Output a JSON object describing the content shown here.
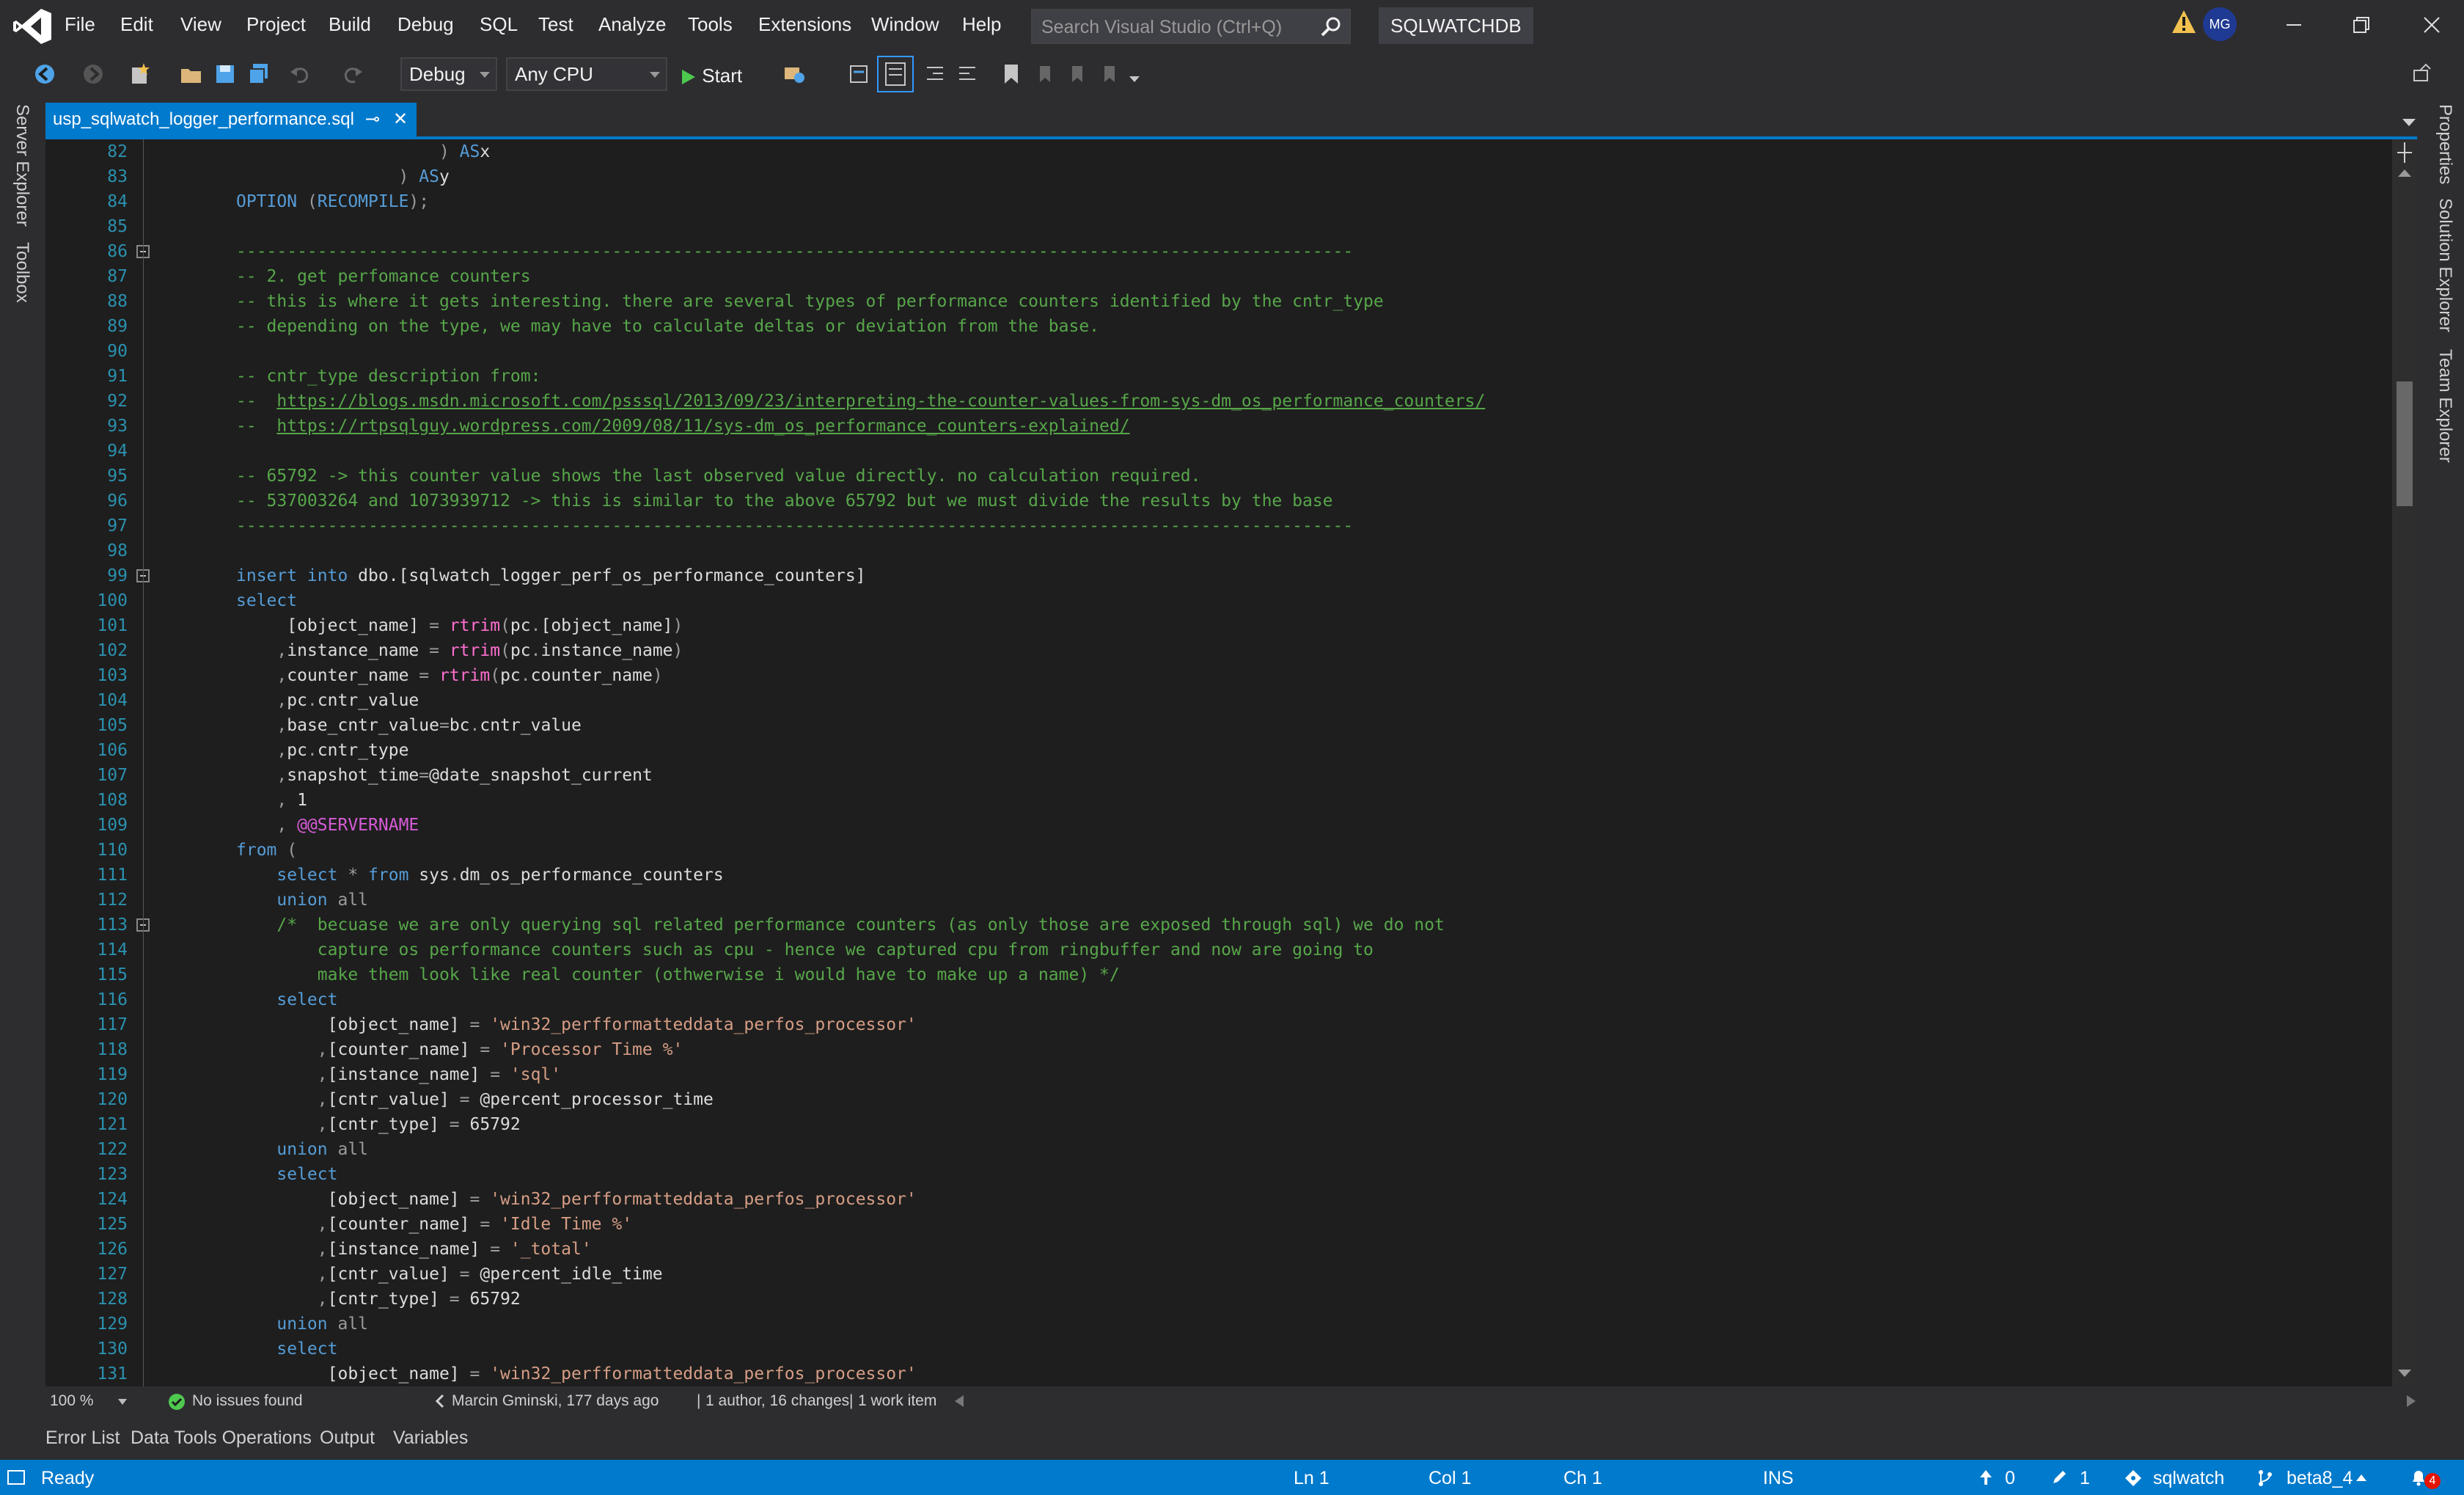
{
  "menu": [
    "File",
    "Edit",
    "View",
    "Project",
    "Build",
    "Debug",
    "SQL",
    "Test",
    "Analyze",
    "Tools",
    "Extensions",
    "Window",
    "Help"
  ],
  "search": {
    "placeholder": "Search Visual Studio (Ctrl+Q)"
  },
  "solution_name": "SQLWATCHDB",
  "user_initials": "MG",
  "toolbar": {
    "config": "Debug",
    "platform": "Any CPU",
    "start_label": "Start"
  },
  "side_left": [
    "Server Explorer",
    "Toolbox"
  ],
  "side_right": [
    "Properties",
    "Solution Explorer",
    "Team Explorer"
  ],
  "tab": {
    "title": "usp_sqlwatch_logger_performance.sql",
    "pin": "⊸",
    "close": "✕"
  },
  "code_lines": [
    {
      "n": "82",
      "t": [
        [
          "op",
          "                    ) "
        ],
        [
          "kw",
          "AS"
        ],
        [
          "",
          "x"
        ]
      ]
    },
    {
      "n": "83",
      "t": [
        [
          "op",
          "                ) "
        ],
        [
          "kw",
          "AS"
        ],
        [
          "",
          "y"
        ]
      ]
    },
    {
      "n": "84",
      "t": [
        [
          "kw",
          "OPTION "
        ],
        [
          "op",
          "("
        ],
        [
          "kw",
          "RECOMPILE"
        ],
        [
          "op",
          ");"
        ]
      ]
    },
    {
      "n": "85",
      "t": []
    },
    {
      "n": "86",
      "t": [
        [
          "cm",
          "--------------------------------------------------------------------------------------------------------------"
        ]
      ]
    },
    {
      "n": "87",
      "t": [
        [
          "cm",
          "-- 2. get perfomance counters"
        ]
      ]
    },
    {
      "n": "88",
      "t": [
        [
          "cm",
          "-- this is where it gets interesting. there are several types of performance counters identified by the cntr_type"
        ]
      ]
    },
    {
      "n": "89",
      "t": [
        [
          "cm",
          "-- depending on the type, we may have to calculate deltas or deviation from the base."
        ]
      ]
    },
    {
      "n": "90",
      "t": []
    },
    {
      "n": "91",
      "t": [
        [
          "cm",
          "-- cntr_type description from:"
        ]
      ]
    },
    {
      "n": "92",
      "t": [
        [
          "cm",
          "--  "
        ],
        [
          "url",
          "https://blogs.msdn.microsoft.com/psssql/2013/09/23/interpreting-the-counter-values-from-sys-dm_os_performance_counters/"
        ]
      ]
    },
    {
      "n": "93",
      "t": [
        [
          "cm",
          "--  "
        ],
        [
          "url",
          "https://rtpsqlguy.wordpress.com/2009/08/11/sys-dm_os_performance_counters-explained/"
        ]
      ]
    },
    {
      "n": "94",
      "t": []
    },
    {
      "n": "95",
      "t": [
        [
          "cm",
          "-- 65792 -> this counter value shows the last observed value directly. no calculation required."
        ]
      ]
    },
    {
      "n": "96",
      "t": [
        [
          "cm",
          "-- 537003264 and 1073939712 -> this is similar to the above 65792 but we must divide the results by the base"
        ]
      ]
    },
    {
      "n": "97",
      "t": [
        [
          "cm",
          "--------------------------------------------------------------------------------------------------------------"
        ]
      ]
    },
    {
      "n": "98",
      "t": []
    },
    {
      "n": "99",
      "t": [
        [
          "kw",
          "insert into "
        ],
        [
          "",
          "dbo.[sqlwatch_logger_perf_os_performance_counters]"
        ]
      ]
    },
    {
      "n": "100",
      "t": [
        [
          "kw",
          "select"
        ]
      ]
    },
    {
      "n": "101",
      "t": [
        [
          "",
          "     [object_name] "
        ],
        [
          "op",
          "= "
        ],
        [
          "fn",
          "rtrim"
        ],
        [
          "op",
          "("
        ],
        [
          "",
          "pc"
        ],
        [
          "op",
          "."
        ],
        [
          "",
          "[object_name]"
        ],
        [
          "op",
          ")"
        ]
      ]
    },
    {
      "n": "102",
      "t": [
        [
          "op",
          "    ,"
        ],
        [
          "",
          "instance_name "
        ],
        [
          "op",
          "= "
        ],
        [
          "fn",
          "rtrim"
        ],
        [
          "op",
          "("
        ],
        [
          "",
          "pc"
        ],
        [
          "op",
          "."
        ],
        [
          "",
          "instance_name"
        ],
        [
          "op",
          ")"
        ]
      ]
    },
    {
      "n": "103",
      "t": [
        [
          "op",
          "    ,"
        ],
        [
          "",
          "counter_name "
        ],
        [
          "op",
          "= "
        ],
        [
          "fn",
          "rtrim"
        ],
        [
          "op",
          "("
        ],
        [
          "",
          "pc"
        ],
        [
          "op",
          "."
        ],
        [
          "",
          "counter_name"
        ],
        [
          "op",
          ")"
        ]
      ]
    },
    {
      "n": "104",
      "t": [
        [
          "op",
          "    ,"
        ],
        [
          "",
          "pc"
        ],
        [
          "op",
          "."
        ],
        [
          "",
          "cntr_value"
        ]
      ]
    },
    {
      "n": "105",
      "t": [
        [
          "op",
          "    ,"
        ],
        [
          "",
          "base_cntr_value"
        ],
        [
          "op",
          "="
        ],
        [
          "",
          "bc"
        ],
        [
          "op",
          "."
        ],
        [
          "",
          "cntr_value"
        ]
      ]
    },
    {
      "n": "106",
      "t": [
        [
          "op",
          "    ,"
        ],
        [
          "",
          "pc"
        ],
        [
          "op",
          "."
        ],
        [
          "",
          "cntr_type"
        ]
      ]
    },
    {
      "n": "107",
      "t": [
        [
          "op",
          "    ,"
        ],
        [
          "",
          "snapshot_time"
        ],
        [
          "op",
          "="
        ],
        [
          "",
          "@date_snapshot_current"
        ]
      ]
    },
    {
      "n": "108",
      "t": [
        [
          "op",
          "    , "
        ],
        [
          "",
          "1"
        ]
      ]
    },
    {
      "n": "109",
      "t": [
        [
          "op",
          "    , "
        ],
        [
          "gl",
          "@@SERVERNAME"
        ]
      ]
    },
    {
      "n": "110",
      "t": [
        [
          "kw",
          "from "
        ],
        [
          "op",
          "("
        ]
      ]
    },
    {
      "n": "111",
      "t": [
        [
          "kw",
          "    select "
        ],
        [
          "op",
          "* "
        ],
        [
          "kw",
          "from "
        ],
        [
          "",
          "sys"
        ],
        [
          "op",
          "."
        ],
        [
          "",
          "dm_os_performance_counters"
        ]
      ]
    },
    {
      "n": "112",
      "t": [
        [
          "kw",
          "    union "
        ],
        [
          "op",
          "all"
        ]
      ]
    },
    {
      "n": "113",
      "t": [
        [
          "cm",
          "    /*  becuase we are only querying sql related performance counters (as only those are exposed through sql) we do not"
        ]
      ]
    },
    {
      "n": "114",
      "t": [
        [
          "cm",
          "        capture os performance counters such as cpu - hence we captured cpu from ringbuffer and now are going to"
        ]
      ]
    },
    {
      "n": "115",
      "t": [
        [
          "cm",
          "        make them look like real counter (othwerwise i would have to make up a name) */"
        ]
      ]
    },
    {
      "n": "116",
      "t": [
        [
          "kw",
          "    select"
        ]
      ]
    },
    {
      "n": "117",
      "t": [
        [
          "",
          "         [object_name] "
        ],
        [
          "op",
          "= "
        ],
        [
          "str",
          "'win32_perfformatteddata_perfos_processor'"
        ]
      ]
    },
    {
      "n": "118",
      "t": [
        [
          "op",
          "        ,"
        ],
        [
          "",
          "[counter_name] "
        ],
        [
          "op",
          "= "
        ],
        [
          "str",
          "'Processor Time %'"
        ]
      ]
    },
    {
      "n": "119",
      "t": [
        [
          "op",
          "        ,"
        ],
        [
          "",
          "[instance_name] "
        ],
        [
          "op",
          "= "
        ],
        [
          "str",
          "'sql'"
        ]
      ]
    },
    {
      "n": "120",
      "t": [
        [
          "op",
          "        ,"
        ],
        [
          "",
          "[cntr_value] "
        ],
        [
          "op",
          "= "
        ],
        [
          "",
          "@percent_processor_time"
        ]
      ]
    },
    {
      "n": "121",
      "t": [
        [
          "op",
          "        ,"
        ],
        [
          "",
          "[cntr_type] "
        ],
        [
          "op",
          "= "
        ],
        [
          "",
          "65792"
        ]
      ]
    },
    {
      "n": "122",
      "t": [
        [
          "kw",
          "    union "
        ],
        [
          "op",
          "all"
        ]
      ]
    },
    {
      "n": "123",
      "t": [
        [
          "kw",
          "    select"
        ]
      ]
    },
    {
      "n": "124",
      "t": [
        [
          "",
          "         [object_name] "
        ],
        [
          "op",
          "= "
        ],
        [
          "str",
          "'win32_perfformatteddata_perfos_processor'"
        ]
      ]
    },
    {
      "n": "125",
      "t": [
        [
          "op",
          "        ,"
        ],
        [
          "",
          "[counter_name] "
        ],
        [
          "op",
          "= "
        ],
        [
          "str",
          "'Idle Time %'"
        ]
      ]
    },
    {
      "n": "126",
      "t": [
        [
          "op",
          "        ,"
        ],
        [
          "",
          "[instance_name] "
        ],
        [
          "op",
          "= "
        ],
        [
          "str",
          "'_total'"
        ]
      ]
    },
    {
      "n": "127",
      "t": [
        [
          "op",
          "        ,"
        ],
        [
          "",
          "[cntr_value] "
        ],
        [
          "op",
          "= "
        ],
        [
          "",
          "@percent_idle_time"
        ]
      ]
    },
    {
      "n": "128",
      "t": [
        [
          "op",
          "        ,"
        ],
        [
          "",
          "[cntr_type] "
        ],
        [
          "op",
          "= "
        ],
        [
          "",
          "65792"
        ]
      ]
    },
    {
      "n": "129",
      "t": [
        [
          "kw",
          "    union "
        ],
        [
          "op",
          "all"
        ]
      ]
    },
    {
      "n": "130",
      "t": [
        [
          "kw",
          "    select"
        ]
      ]
    },
    {
      "n": "131",
      "t": [
        [
          "",
          "         [object_name] "
        ],
        [
          "op",
          "= "
        ],
        [
          "str",
          "'win32_perfformatteddata_perfos_processor'"
        ]
      ]
    }
  ],
  "editor_status": {
    "zoom": "100 %",
    "issues": "No issues found",
    "codelens_author": "Marcin Gminski, 177 days ago",
    "codelens_changes": "1 author, 16 changes",
    "codelens_items": "1 work item"
  },
  "tool_tabs": [
    "Error List",
    "Data Tools Operations",
    "Output",
    "Variables"
  ],
  "statusbar": {
    "ready": "Ready",
    "ln": "Ln 1",
    "col": "Col 1",
    "ch": "Ch 1",
    "ins": "INS",
    "push": "0",
    "edits": "1",
    "repo": "sqlwatch",
    "branch": "beta8_4",
    "notifications": "4"
  },
  "colors": {
    "accent": "#007acc",
    "editor_bg": "#1e1e1e",
    "chrome": "#2d2d30"
  }
}
